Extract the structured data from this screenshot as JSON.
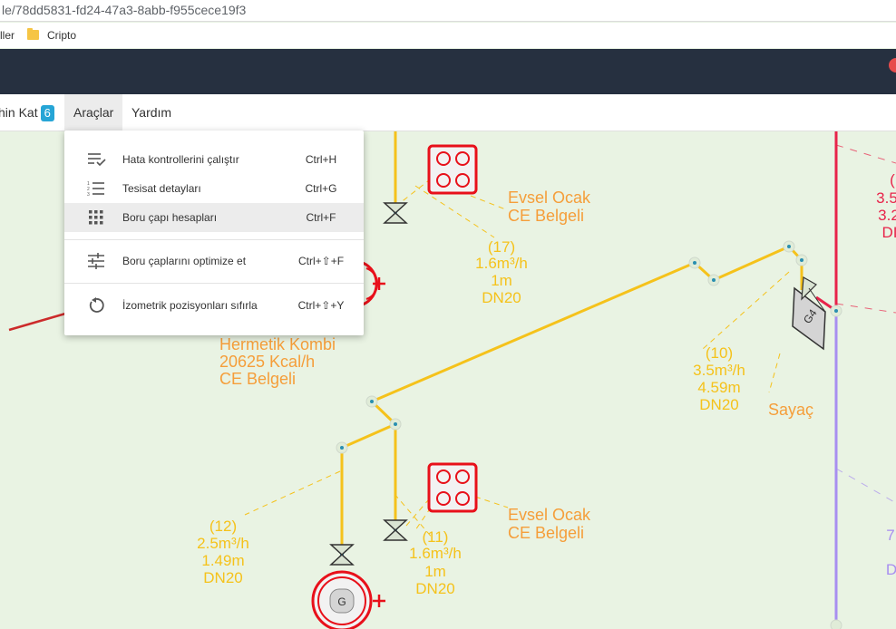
{
  "browser": {
    "url": "le/78dd5831-fd24-47a3-8abb-f955cece19f3",
    "bookmarks": [
      {
        "label": "ller"
      },
      {
        "label": "Cripto"
      }
    ]
  },
  "menubar": {
    "items": [
      {
        "label": "hin Kat",
        "badge": "6"
      },
      {
        "label": "Araçlar"
      },
      {
        "label": "Yardım"
      }
    ]
  },
  "dropdown": {
    "items": [
      {
        "label": "Hata kontrollerini çalıştır",
        "shortcut": "Ctrl+H",
        "icon": "checklist-icon"
      },
      {
        "label": "Tesisat detayları",
        "shortcut": "Ctrl+G",
        "icon": "numbered-list-icon"
      },
      {
        "label": "Boru çapı hesapları",
        "shortcut": "Ctrl+F",
        "icon": "grid-icon",
        "highlighted": true
      },
      {
        "label": "Boru çaplarını optimize et",
        "shortcut": "Ctrl+⇧+F",
        "icon": "sliders-icon"
      },
      {
        "label": "İzometrik pozisyonları sıfırla",
        "shortcut": "Ctrl+⇧+Y",
        "icon": "reset-icon"
      }
    ]
  },
  "diagram": {
    "appliances": [
      {
        "name": "Evsel Ocak",
        "cert": "CE Belgeli"
      },
      {
        "name": "Hermetik Kombi",
        "capacity": "20625 Kcal/h",
        "cert": "CE Belgeli"
      },
      {
        "name": "Evsel Ocak",
        "cert": "CE Belgeli"
      }
    ],
    "pipe_labels": [
      {
        "id": "(17)",
        "flow": "1.6m³/h",
        "length": "1m",
        "dn": "DN20"
      },
      {
        "id": "(10)",
        "flow": "3.5m³/h",
        "length": "4.59m",
        "dn": "DN20"
      },
      {
        "id": "(12)",
        "flow": "2.5m³/h",
        "length": "1.49m",
        "dn": "DN20"
      },
      {
        "id": "(11)",
        "flow": "1.6m³/h",
        "length": "1m",
        "dn": "DN20"
      }
    ],
    "meter_label": "Sayaç",
    "meter_code": "G4",
    "combi_code": "G",
    "right_partial": {
      "lines": [
        "(",
        "3.5",
        "3.2",
        "DI"
      ]
    },
    "right_partial2": {
      "lines": [
        "7",
        "D"
      ]
    }
  },
  "colors": {
    "pipe": "#f5c21b",
    "label": "#f59e3a",
    "riser_red": "#e8234a",
    "riser_purple": "#a88ef0",
    "appbar": "#263040"
  }
}
